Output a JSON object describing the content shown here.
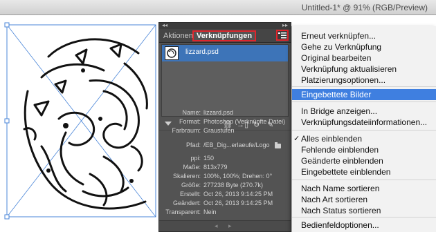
{
  "document": {
    "title": "Untitled-1* @ 91% (RGB/Preview)"
  },
  "panel": {
    "tabs": [
      {
        "label": "Aktionen",
        "active": false
      },
      {
        "label": "Verknüpfungen",
        "active": true
      }
    ],
    "links": [
      {
        "name": "lizzard.psd"
      }
    ],
    "info": [
      {
        "label": "Name:",
        "value": "lizzard.psd"
      },
      {
        "label": "Format:",
        "value": "Photoshop (Verknüpfte Datei)"
      },
      {
        "label": "Farbraum:",
        "value": "Graustufen"
      },
      {
        "label": "Pfad:",
        "value": "/EB_Dig...erlaeufe/Logo"
      },
      {
        "label": "ppi:",
        "value": "150"
      },
      {
        "label": "Maße:",
        "value": "813x779"
      },
      {
        "label": "Skalieren:",
        "value": "100%, 100%; Drehen: 0°"
      },
      {
        "label": "Größe:",
        "value": "277238 Byte (270.7k)"
      },
      {
        "label": "Erstellt:",
        "value": "Oct 26, 2013 9:14:25 PM"
      },
      {
        "label": "Geändert:",
        "value": "Oct 26, 2013 9:14:25 PM"
      },
      {
        "label": "Transparent:",
        "value": "Nein"
      }
    ],
    "toolbar_icons": [
      "relink-icon",
      "go-to-link-icon",
      "update-link-icon",
      "edit-original-icon"
    ]
  },
  "menu": {
    "items": [
      {
        "label": "Erneut verknüpfen..."
      },
      {
        "label": "Gehe zu Verknüpfung"
      },
      {
        "label": "Original bearbeiten"
      },
      {
        "label": "Verknüpfung aktualisieren"
      },
      {
        "label": "Platzierungsoptionen..."
      },
      {
        "label": "Eingebettete Bilder",
        "highlighted": true
      },
      {
        "label": "In Bridge anzeigen..."
      },
      {
        "label": "Verknüpfungsdateiinformationen..."
      },
      {
        "label": "Alles einblenden",
        "checked": true
      },
      {
        "label": "Fehlende einblenden"
      },
      {
        "label": "Geänderte einblenden"
      },
      {
        "label": "Eingebettete einblenden"
      },
      {
        "label": "Nach Name sortieren"
      },
      {
        "label": "Nach Art sortieren"
      },
      {
        "label": "Nach Status sortieren"
      },
      {
        "label": "Bedienfeldoptionen..."
      }
    ]
  },
  "colors": {
    "highlight": "#3f7fe0",
    "selection_row": "#3d74b8",
    "callout": "#e0252c",
    "panel_bg": "#535353"
  }
}
